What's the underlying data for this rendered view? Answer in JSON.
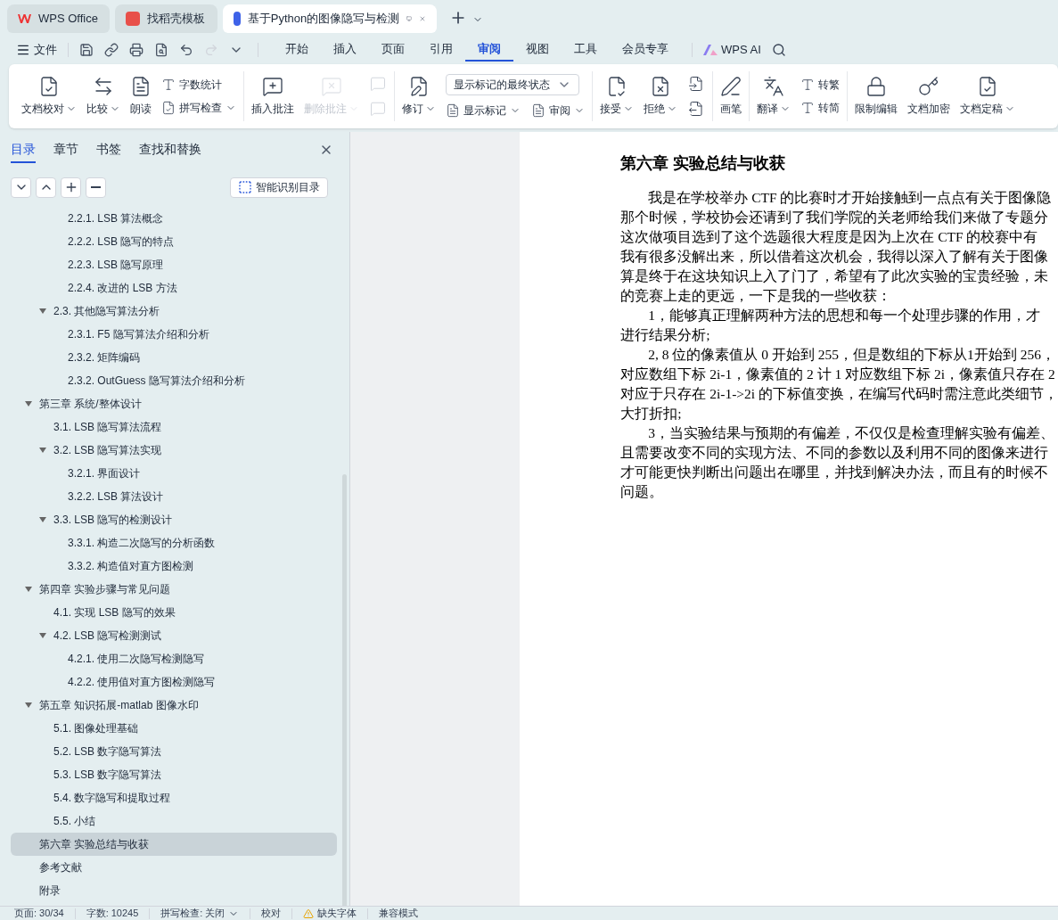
{
  "browser_tabs": [
    {
      "label": "WPS Office",
      "selected": false
    },
    {
      "label": "找稻壳模板",
      "selected": false
    },
    {
      "label": "基于Python的图像隐写与检测",
      "selected": true
    }
  ],
  "menu": {
    "file": "文件",
    "tabs": [
      {
        "label": "开始",
        "selected": false
      },
      {
        "label": "插入",
        "selected": false
      },
      {
        "label": "页面",
        "selected": false
      },
      {
        "label": "引用",
        "selected": false
      },
      {
        "label": "审阅",
        "selected": true
      },
      {
        "label": "视图",
        "selected": false
      },
      {
        "label": "工具",
        "selected": false
      },
      {
        "label": "会员专享",
        "selected": false
      }
    ],
    "ai": "WPS AI"
  },
  "ribbon": {
    "groups": [
      {
        "columns": [
          {
            "kind": "large",
            "items": [
              {
                "label": "文档校对",
                "caret": true,
                "disabled": false
              }
            ]
          },
          {
            "kind": "large",
            "items": [
              {
                "label": "比较",
                "caret": true,
                "disabled": false
              }
            ]
          },
          {
            "kind": "large",
            "items": [
              {
                "label": "朗读",
                "caret": false,
                "disabled": false
              }
            ]
          },
          {
            "kind": "stack",
            "items": [
              {
                "kind": "small",
                "label": "字数统计",
                "caret": false,
                "disabled": false
              },
              {
                "kind": "small",
                "label": "拼写检查",
                "caret": true,
                "disabled": false
              }
            ]
          }
        ]
      },
      {
        "columns": [
          {
            "kind": "large",
            "items": [
              {
                "label": "插入批注",
                "caret": false,
                "disabled": false
              }
            ]
          },
          {
            "kind": "large",
            "items": [
              {
                "label": "删除批注",
                "caret": true,
                "disabled": true
              }
            ]
          },
          {
            "kind": "stack",
            "items": [
              {
                "kind": "icon",
                "disabled": true
              },
              {
                "kind": "icon",
                "disabled": true
              }
            ]
          }
        ]
      },
      {
        "columns": [
          {
            "kind": "large",
            "items": [
              {
                "label": "修订",
                "caret": true,
                "disabled": false
              }
            ]
          },
          {
            "kind": "stack",
            "items": [
              {
                "kind": "dropdown",
                "label": "显示标记的最终状态",
                "disabled": false
              },
              {
                "kind": "pair",
                "items": [
                  {
                    "label": "显示标记",
                    "caret": true
                  },
                  {
                    "label": "审阅",
                    "caret": true
                  }
                ],
                "disabled": false
              }
            ]
          }
        ]
      },
      {
        "columns": [
          {
            "kind": "large",
            "items": [
              {
                "label": "接受",
                "caret": true,
                "disabled": false
              }
            ]
          },
          {
            "kind": "large",
            "items": [
              {
                "label": "拒绝",
                "caret": true,
                "disabled": false
              }
            ]
          },
          {
            "kind": "stack",
            "items": [
              {
                "kind": "icon",
                "disabled": false
              },
              {
                "kind": "icon",
                "disabled": false
              }
            ]
          }
        ]
      },
      {
        "columns": [
          {
            "kind": "large",
            "items": [
              {
                "label": "画笔",
                "caret": false,
                "disabled": false
              }
            ]
          }
        ]
      },
      {
        "columns": [
          {
            "kind": "large",
            "items": [
              {
                "label": "翻译",
                "caret": true,
                "disabled": false
              }
            ]
          },
          {
            "kind": "stack",
            "items": [
              {
                "kind": "small",
                "label": "转繁",
                "caret": false,
                "disabled": false
              },
              {
                "kind": "small",
                "label": "转简",
                "caret": false,
                "disabled": false
              }
            ]
          }
        ]
      },
      {
        "columns": [
          {
            "kind": "large",
            "items": [
              {
                "label": "限制编辑",
                "caret": false,
                "disabled": false
              }
            ]
          },
          {
            "kind": "large",
            "items": [
              {
                "label": "文档加密",
                "caret": false,
                "disabled": false
              }
            ]
          },
          {
            "kind": "large",
            "items": [
              {
                "label": "文档定稿",
                "caret": true,
                "disabled": false
              }
            ]
          }
        ]
      }
    ]
  },
  "panel": {
    "tabs": [
      {
        "label": "目录",
        "selected": true
      },
      {
        "label": "章节",
        "selected": false
      },
      {
        "label": "书签",
        "selected": false
      },
      {
        "label": "查找和替换",
        "selected": false
      }
    ],
    "smart_button": "智能识别目录",
    "toc": [
      {
        "children": [
          {
            "children": [
              {
                "label": "2.2.1. LSB 算法概念",
                "selected": false
              },
              {
                "label": "2.2.2. LSB 隐写的特点",
                "selected": false
              },
              {
                "label": "2.2.3. LSB 隐写原理",
                "selected": false
              },
              {
                "label": "2.2.4.  改进的 LSB 方法",
                "selected": false
              }
            ]
          },
          {
            "label": "2.3.  其他隐写算法分析",
            "selected": false,
            "expanded": true,
            "children": [
              {
                "label": "2.3.1. F5 隐写算法介绍和分析",
                "selected": false
              },
              {
                "label": "2.3.2.  矩阵编码",
                "selected": false
              },
              {
                "label": "2.3.2. OutGuess 隐写算法介绍和分析",
                "selected": false
              }
            ]
          }
        ]
      },
      {
        "label": "第三章  系统/整体设计",
        "selected": false,
        "expanded": true,
        "children": [
          {
            "label": "3.1. LSB 隐写算法流程",
            "selected": false
          },
          {
            "label": "3.2. LSB 隐写算法实现",
            "selected": false,
            "expanded": true,
            "children": [
              {
                "label": "3.2.1.  界面设计",
                "selected": false
              },
              {
                "label": "3.2.2. LSB 算法设计",
                "selected": false
              }
            ]
          },
          {
            "label": "3.3. LSB 隐写的检测设计",
            "selected": false,
            "expanded": true,
            "children": [
              {
                "label": "3.3.1.  构造二次隐写的分析函数",
                "selected": false
              },
              {
                "label": "3.3.2.  构造值对直方图检测",
                "selected": false
              }
            ]
          }
        ]
      },
      {
        "label": "第四章  实验步骤与常见问题",
        "selected": false,
        "expanded": true,
        "children": [
          {
            "label": "4.1.  实现 LSB 隐写的效果",
            "selected": false
          },
          {
            "label": "4.2. LSB 隐写检测测试",
            "selected": false,
            "expanded": true,
            "children": [
              {
                "label": "4.2.1.  使用二次隐写检测隐写",
                "selected": false
              },
              {
                "label": "4.2.2.  使用值对直方图检测隐写",
                "selected": false
              }
            ]
          }
        ]
      },
      {
        "label": "第五章  知识拓展-matlab 图像水印",
        "selected": false,
        "expanded": true,
        "children": [
          {
            "label": "5.1.  图像处理基础",
            "selected": false
          },
          {
            "label": "5.2. LSB 数字隐写算法",
            "selected": false
          },
          {
            "label": "5.3. LSB 数字隐写算法",
            "selected": false
          },
          {
            "label": "5.4.  数字隐写和提取过程",
            "selected": false
          },
          {
            "label": "5.5.  小结",
            "selected": false
          }
        ]
      },
      {
        "label": "第六章  实验总结与收获",
        "selected": true
      },
      {
        "label": "参考文献",
        "selected": false
      },
      {
        "label": "附录",
        "selected": false
      }
    ]
  },
  "document": {
    "heading": "第六章  实验总结与收获",
    "lines": [
      {
        "text": "我是在学校举办 CTF 的比赛时才开始接触到一点点有关于图像隐",
        "indent": true
      },
      {
        "text": "那个时候，学校协会还请到了我们学院的关老师给我们来做了专题分",
        "indent": false
      },
      {
        "text": "这次做项目选到了这个选题很大程度是因为上次在 CTF 的校赛中有",
        "indent": false
      },
      {
        "text": "我有很多没解出来，所以借着这次机会，我得以深入了解有关于图像",
        "indent": false
      },
      {
        "text": "算是终于在这块知识上入了门了，希望有了此次实验的宝贵经验，未",
        "indent": false
      },
      {
        "text": "的竞赛上走的更远，一下是我的一些收获：",
        "indent": false
      },
      {
        "text": "1，能够真正理解两种方法的思想和每一个处理步骤的作用，才",
        "indent": true
      },
      {
        "text": "进行结果分析;",
        "indent": false
      },
      {
        "text": "2, 8 位的像素值从 0 开始到 255，但是数组的下标从1开始到 256，",
        "indent": true
      },
      {
        "text": "对应数组下标 2i-1，像素值的  2 计 1 对应数组下标 2i，像素值只存在 2",
        "indent": false
      },
      {
        "text": "对应于只存在 2i-1->2i  的下标值变换，在编写代码时需注意此类细节，",
        "indent": false
      },
      {
        "text": "大打折扣;",
        "indent": false
      },
      {
        "text": "3，当实验结果与预期的有偏差，不仅仅是检查理解实验有偏差、",
        "indent": true
      },
      {
        "text": "且需要改变不同的实现方法、不同的参数以及利用不同的图像来进行",
        "indent": false
      },
      {
        "text": "才可能更快判断出问题出在哪里，并找到解决办法，而且有的时候不",
        "indent": false
      },
      {
        "text": "问题。",
        "indent": false
      }
    ]
  },
  "status_bar": [
    {
      "kind": "text",
      "label": "页面: 30/34"
    },
    {
      "kind": "text",
      "label": "字数: 10245"
    },
    {
      "kind": "menu",
      "label": "拼写检查: 关闭"
    },
    {
      "kind": "text",
      "label": "校对"
    },
    {
      "kind": "warning",
      "label": "缺失字体"
    },
    {
      "kind": "text",
      "label": "兼容模式"
    }
  ]
}
